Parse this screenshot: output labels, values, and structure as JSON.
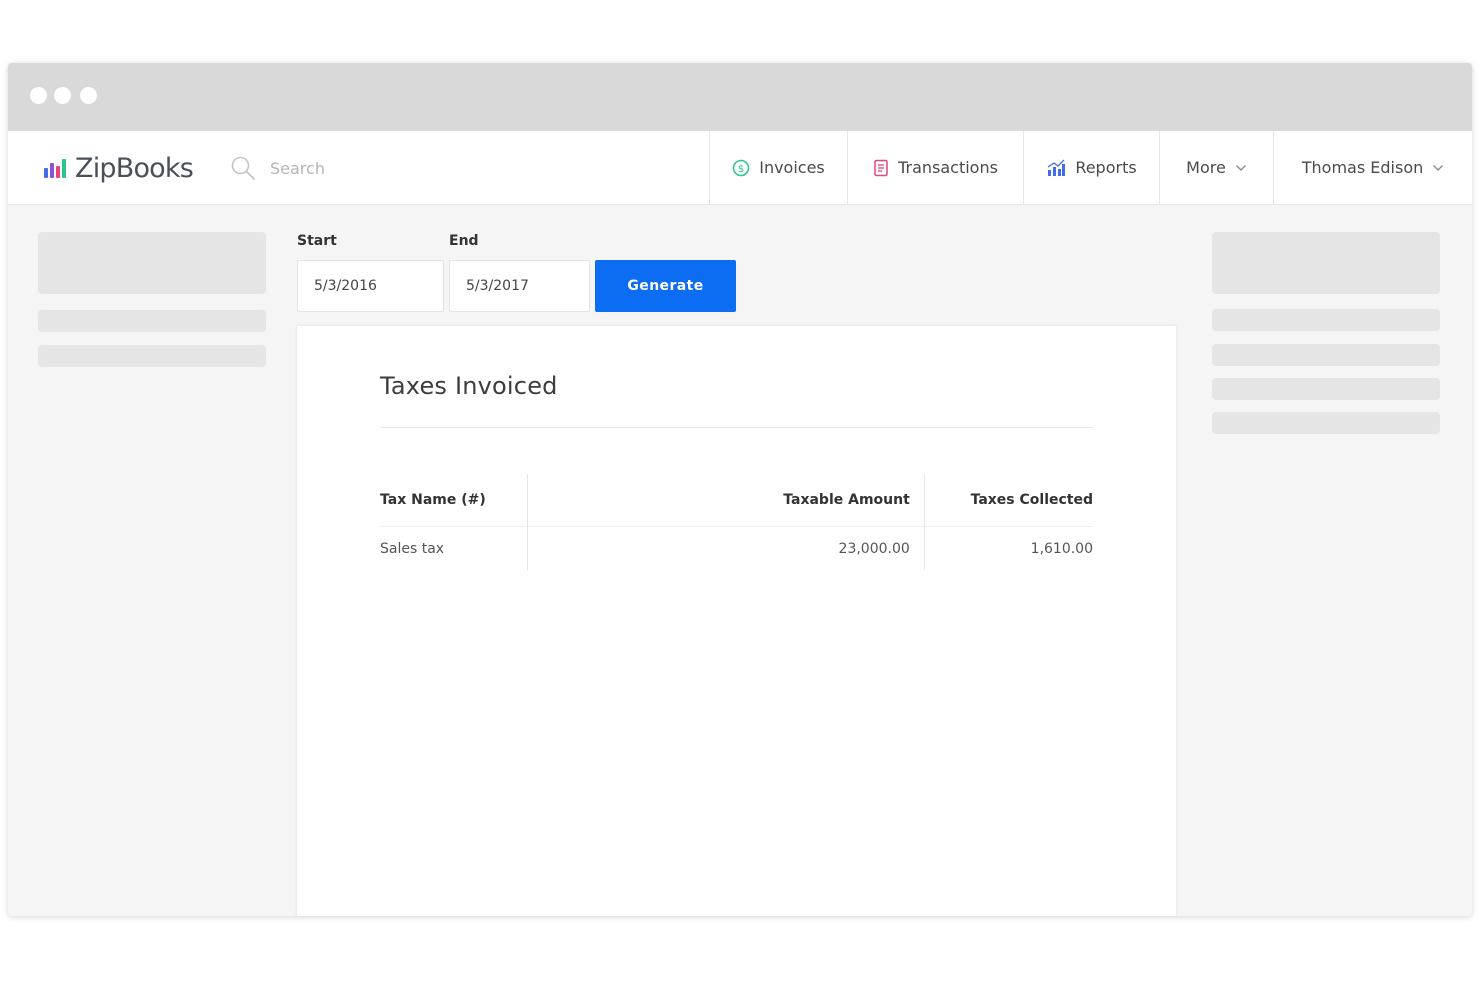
{
  "app": {
    "brand": "ZipBooks",
    "brand_colors": [
      "#3f6ee8",
      "#8a53d9",
      "#e6447a",
      "#2bc48a"
    ]
  },
  "search": {
    "placeholder": "Search"
  },
  "nav": {
    "invoices": {
      "label": "Invoices",
      "icon": "dollar-circle-icon",
      "color": "#2bc48a"
    },
    "transactions": {
      "label": "Transactions",
      "icon": "receipt-icon",
      "color": "#e6447a"
    },
    "reports": {
      "label": "Reports",
      "icon": "bar-chart-icon",
      "color": "#3f6ee8"
    },
    "more": {
      "label": "More",
      "icon": "chevron-down-icon"
    },
    "user": {
      "label": "Thomas Edison",
      "icon": "chevron-down-icon"
    }
  },
  "filters": {
    "start_label": "Start",
    "start_value": "5/3/2016",
    "end_label": "End",
    "end_value": "5/3/2017",
    "generate_label": "Generate",
    "accent": "#0c6cf2"
  },
  "report": {
    "title": "Taxes Invoiced",
    "columns": [
      "Tax Name (#)",
      "Taxable Amount",
      "Taxes Collected"
    ],
    "rows": [
      [
        "Sales tax",
        "23,000.00",
        "1,610.00"
      ]
    ]
  }
}
